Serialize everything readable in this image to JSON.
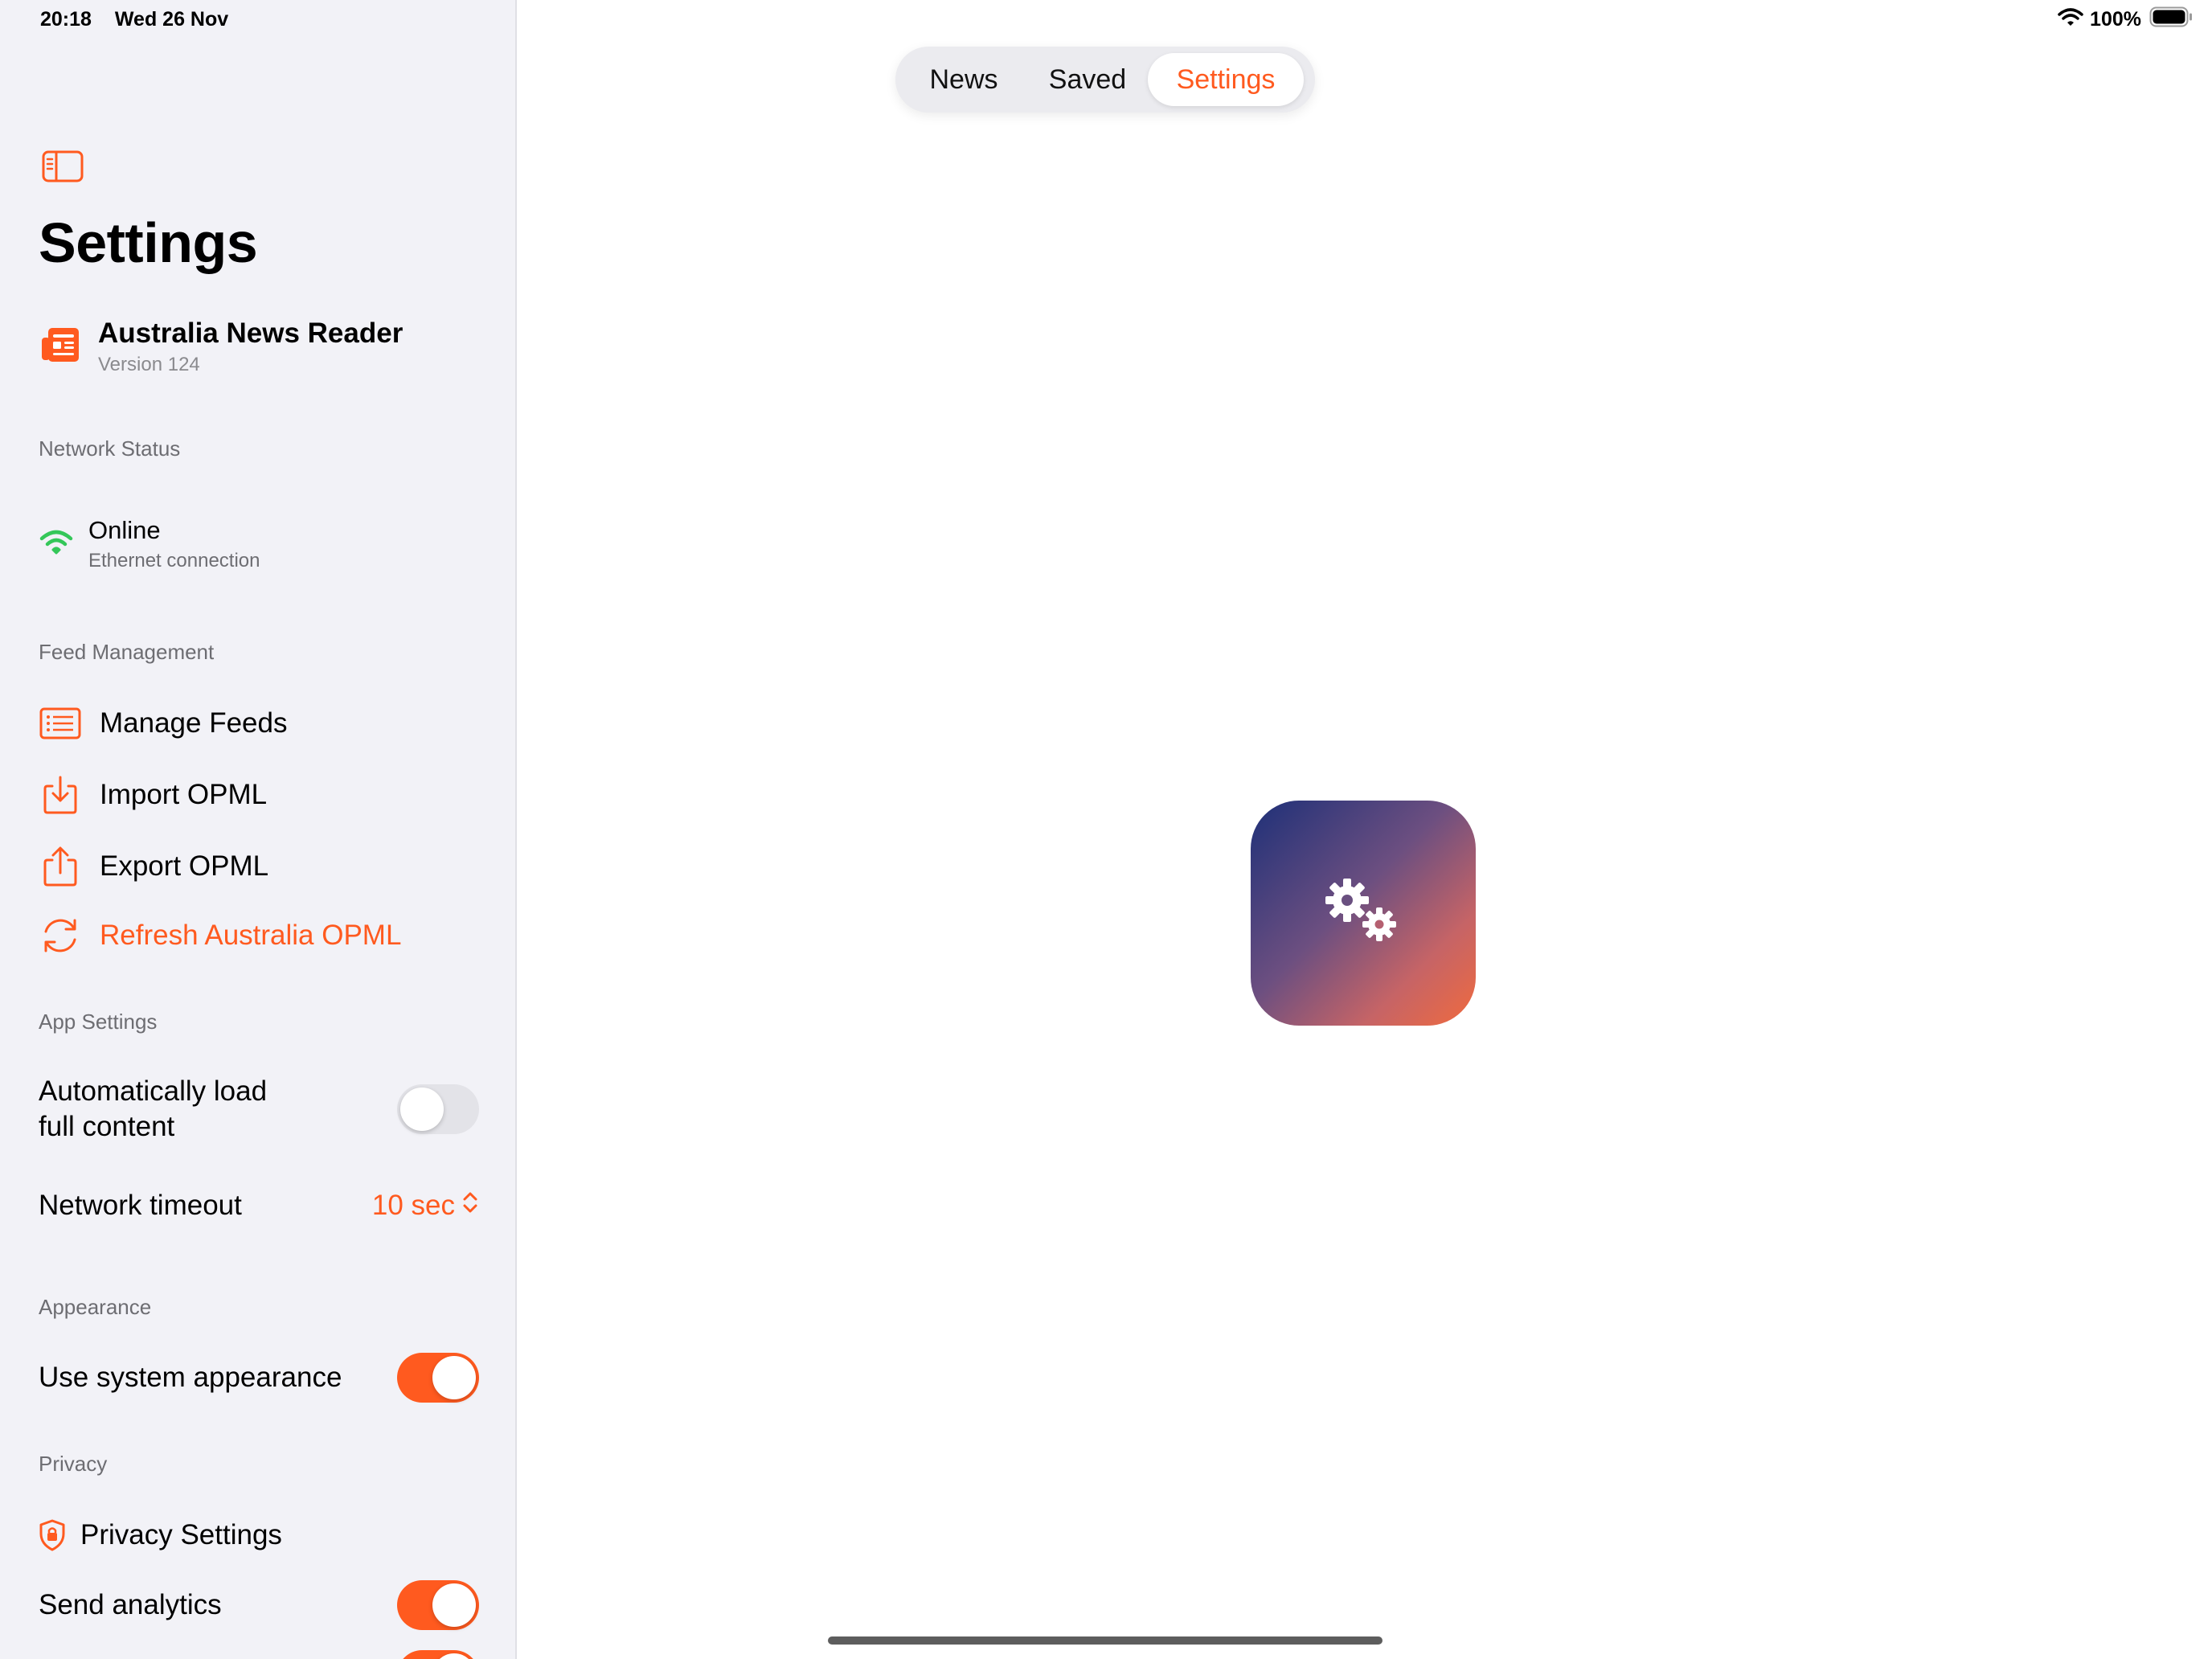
{
  "status_bar": {
    "time": "20:18",
    "date": "Wed 26 Nov",
    "battery": "100%"
  },
  "sidebar": {
    "title": "Settings",
    "app": {
      "name": "Australia News Reader",
      "version": "Version 124"
    },
    "network": {
      "header": "Network Status",
      "status": "Online",
      "detail": "Ethernet connection"
    },
    "feed_management": {
      "header": "Feed Management",
      "items": [
        {
          "label": "Manage Feeds",
          "icon": "list-icon"
        },
        {
          "label": "Import OPML",
          "icon": "import-icon"
        },
        {
          "label": "Export OPML",
          "icon": "share-icon"
        },
        {
          "label": "Refresh Australia OPML",
          "icon": "refresh-icon"
        }
      ]
    },
    "app_settings": {
      "header": "App Settings",
      "auto_load_line1": "Automatically load",
      "auto_load_line2": "full content",
      "auto_load_on": false,
      "timeout_label": "Network timeout",
      "timeout_value": "10 sec"
    },
    "appearance": {
      "header": "Appearance",
      "system_label": "Use system appearance",
      "system_on": true
    },
    "privacy": {
      "header": "Privacy",
      "settings_label": "Privacy Settings",
      "analytics_label": "Send analytics",
      "analytics_on": true
    }
  },
  "tabs": [
    {
      "label": "News",
      "selected": false
    },
    {
      "label": "Saved",
      "selected": false
    },
    {
      "label": "Settings",
      "selected": true
    }
  ],
  "colors": {
    "accent": "#ff5a1f",
    "online": "#34c759",
    "sidebar_bg": "#f2f2f7"
  },
  "center_icon": "gears-icon"
}
